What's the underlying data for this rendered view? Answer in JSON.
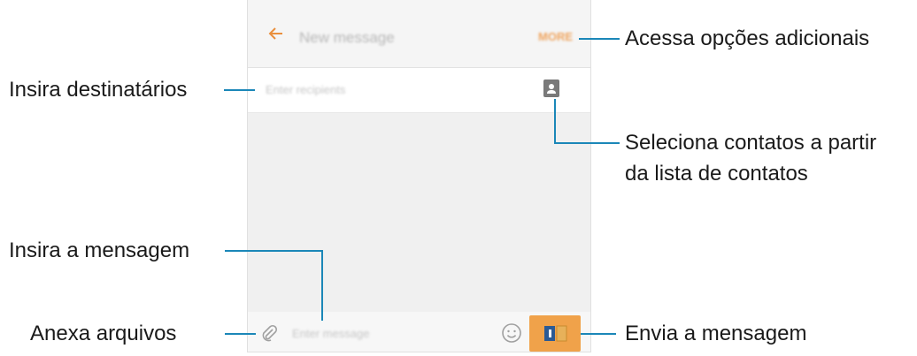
{
  "screen": {
    "app_bar": {
      "title": "New message",
      "more_label": "MORE"
    },
    "recipients": {
      "placeholder": "Enter recipients"
    },
    "composer": {
      "placeholder": "Enter message"
    }
  },
  "callouts": {
    "more_options": "Acessa opções adicionais",
    "enter_recipients": "Insira destinatários",
    "select_contacts_line1": "Seleciona contatos a partir",
    "select_contacts_line2": "da lista de contatos",
    "enter_message": "Insira a mensagem",
    "attach_files": "Anexa arquivos",
    "send_message": "Envia a mensagem"
  },
  "colors": {
    "accent": "#f0a24a",
    "callout_line": "#1b87b8"
  }
}
